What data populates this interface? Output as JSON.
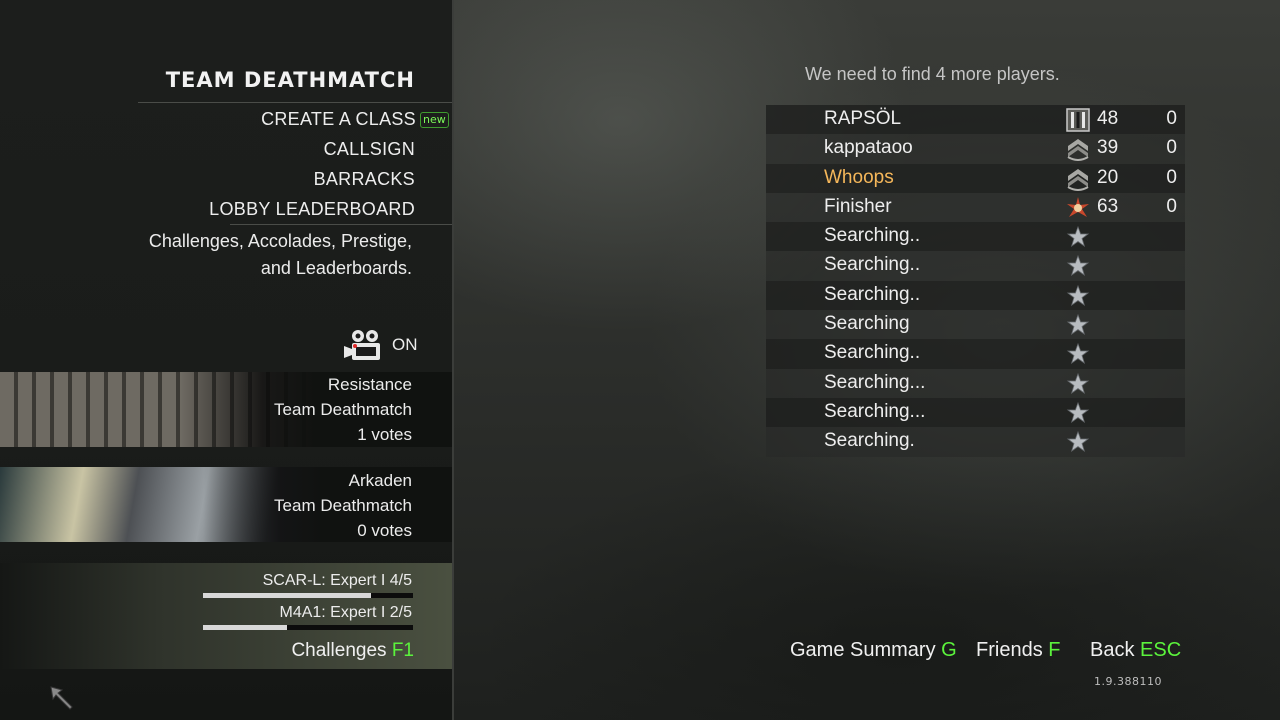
{
  "lobby": {
    "title": "TEAM DEATHMATCH",
    "menu": [
      {
        "label": "CREATE A CLASS",
        "badge": "new"
      },
      {
        "label": "CALLSIGN"
      },
      {
        "label": "BARRACKS"
      },
      {
        "label": "LOBBY LEADERBOARD"
      }
    ],
    "description_line1": "Challenges, Accolades, Prestige,",
    "description_line2": "and Leaderboards.",
    "camera": {
      "icon": "movie-camera-icon",
      "state": "ON"
    }
  },
  "maps": [
    {
      "name": "Resistance",
      "mode": "Team Deathmatch",
      "votes": "1 votes"
    },
    {
      "name": "Arkaden",
      "mode": "Team Deathmatch",
      "votes": "0 votes"
    }
  ],
  "challenges": {
    "items": [
      {
        "label": "SCAR-L: Expert I  4/5",
        "progress": 0.8
      },
      {
        "label": "M4A1: Expert I  2/5",
        "progress": 0.4
      }
    ],
    "button_label": "Challenges",
    "button_key": "F1"
  },
  "status": "We need to find 4 more players.",
  "players": [
    {
      "name": "RAPSÖL",
      "level": "48",
      "score": "0",
      "rank_icon": "rank-bars-icon",
      "highlight": false
    },
    {
      "name": "kappataoo",
      "level": "39",
      "score": "0",
      "rank_icon": "rank-chevron-icon",
      "highlight": false
    },
    {
      "name": "Whoops",
      "level": "20",
      "score": "0",
      "rank_icon": "rank-chevron-icon",
      "highlight": true
    },
    {
      "name": "Finisher",
      "level": "63",
      "score": "0",
      "rank_icon": "rank-star-burst-icon",
      "highlight": false
    },
    {
      "name": "Searching..",
      "level": "",
      "score": "",
      "rank_icon": "rank-star-icon",
      "highlight": false
    },
    {
      "name": "Searching..",
      "level": "",
      "score": "",
      "rank_icon": "rank-star-icon",
      "highlight": false
    },
    {
      "name": "Searching..",
      "level": "",
      "score": "",
      "rank_icon": "rank-star-icon",
      "highlight": false
    },
    {
      "name": "Searching",
      "level": "",
      "score": "",
      "rank_icon": "rank-star-icon",
      "highlight": false
    },
    {
      "name": "Searching..",
      "level": "",
      "score": "",
      "rank_icon": "rank-star-icon",
      "highlight": false
    },
    {
      "name": "Searching...",
      "level": "",
      "score": "",
      "rank_icon": "rank-star-icon",
      "highlight": false
    },
    {
      "name": "Searching...",
      "level": "",
      "score": "",
      "rank_icon": "rank-star-icon",
      "highlight": false
    },
    {
      "name": "Searching.",
      "level": "",
      "score": "",
      "rank_icon": "rank-star-icon",
      "highlight": false
    }
  ],
  "footer": {
    "game_summary_label": "Game Summary",
    "game_summary_key": "G",
    "friends_label": "Friends",
    "friends_key": "F",
    "back_label": "Back",
    "back_key": "ESC",
    "version": "1.9.388110"
  },
  "colors": {
    "accent_green": "#5bf33c",
    "highlight_orange": "#f5b75a"
  }
}
